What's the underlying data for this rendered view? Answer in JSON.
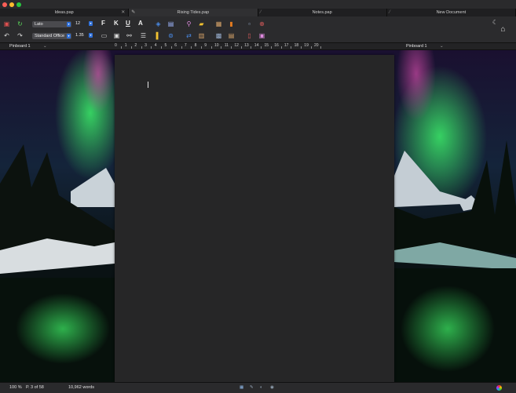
{
  "tabs": [
    {
      "label": "Ideas.pap",
      "active": false
    },
    {
      "label": "Rising Tides.pap",
      "active": true
    },
    {
      "label": "Notes.pap",
      "active": false
    },
    {
      "label": "New Document",
      "active": false
    }
  ],
  "toolbar": {
    "font_name": "Lato",
    "font_size": "12",
    "style_name": "Standard Office",
    "line_spacing": "1.35",
    "bold": "F",
    "italic": "K",
    "underline": "U",
    "aa": "A"
  },
  "ruler": {
    "left_label": "Pinboard 1",
    "right_label": "Pinboard 1",
    "marks": [
      "0",
      "1",
      "2",
      "3",
      "4",
      "5",
      "6",
      "7",
      "8",
      "9",
      "10",
      "11",
      "12",
      "13",
      "14",
      "15",
      "16",
      "17",
      "18",
      "19",
      "20"
    ]
  },
  "status": {
    "zoom": "100 %",
    "page": "P. 3 of 58",
    "words": "10,962 words"
  },
  "colors": {
    "accent": "#2e6fd8",
    "traffic_red": "#ff5f57",
    "traffic_yellow": "#febc2e",
    "traffic_green": "#28c840"
  }
}
